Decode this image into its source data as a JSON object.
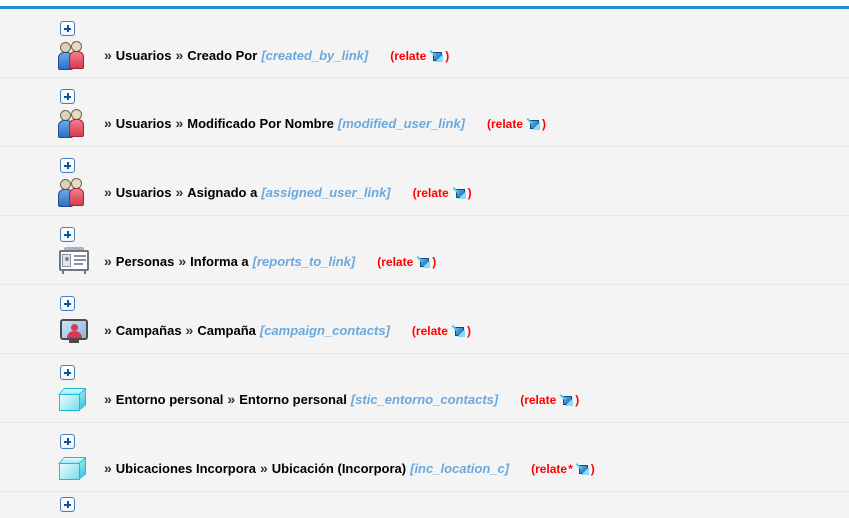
{
  "page": {
    "background_color": "#f4f4f4",
    "top_rule_color": "#2a8fd0",
    "link_color": "#6aa8e0",
    "relate_color": "#ff0000"
  },
  "relationships": [
    {
      "expand_label": "+",
      "icon": "users-icon",
      "chevron": "»",
      "module": "Usuarios",
      "field": "Creado Por",
      "link_name": "[created_by_link]",
      "type_prefix": "(relate",
      "type_star": "",
      "type_suffix": ")",
      "arrow_icon": "relate-arrow-icon"
    },
    {
      "expand_label": "+",
      "icon": "users-icon",
      "chevron": "»",
      "module": "Usuarios",
      "field": "Modificado Por Nombre",
      "link_name": "[modified_user_link]",
      "type_prefix": "(relate",
      "type_star": "",
      "type_suffix": ")",
      "arrow_icon": "relate-arrow-icon"
    },
    {
      "expand_label": "+",
      "icon": "users-icon",
      "chevron": "»",
      "module": "Usuarios",
      "field": "Asignado a",
      "link_name": "[assigned_user_link]",
      "type_prefix": "(relate",
      "type_star": "",
      "type_suffix": ")",
      "arrow_icon": "relate-arrow-icon"
    },
    {
      "expand_label": "+",
      "icon": "contact-card-icon",
      "chevron": "»",
      "module": "Personas",
      "field": "Informa a",
      "link_name": "[reports_to_link]",
      "type_prefix": "(relate",
      "type_star": "",
      "type_suffix": ")",
      "arrow_icon": "relate-arrow-icon"
    },
    {
      "expand_label": "+",
      "icon": "campaign-screen-icon",
      "chevron": "»",
      "module": "Campañas",
      "field": "Campaña",
      "link_name": "[campaign_contacts]",
      "type_prefix": "(relate",
      "type_star": "",
      "type_suffix": ")",
      "arrow_icon": "relate-arrow-icon"
    },
    {
      "expand_label": "+",
      "icon": "cube-icon",
      "chevron": "»",
      "module": "Entorno personal",
      "field": "Entorno personal",
      "link_name": "[stic_entorno_contacts]",
      "type_prefix": "(relate",
      "type_star": "",
      "type_suffix": ")",
      "arrow_icon": "relate-arrow-icon"
    },
    {
      "expand_label": "+",
      "icon": "cube-icon",
      "chevron": "»",
      "module": "Ubicaciones Incorpora",
      "field": "Ubicación (Incorpora)",
      "link_name": "[inc_location_c]",
      "type_prefix": "(relate",
      "type_star": "*",
      "type_suffix": ")",
      "arrow_icon": "relate-arrow-icon"
    }
  ],
  "partial_next_row": {
    "expand_label": "+"
  }
}
